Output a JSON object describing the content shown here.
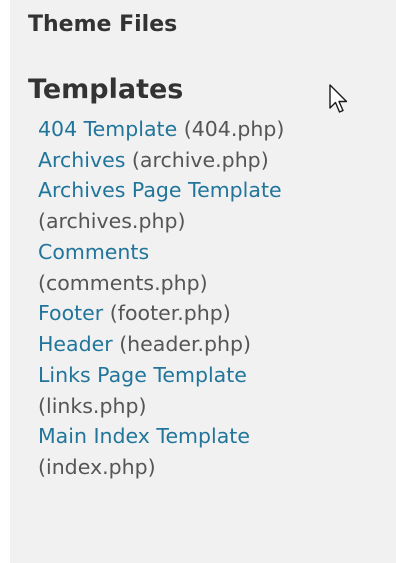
{
  "sidebar": {
    "title": "Theme Files",
    "section_title": "Templates",
    "files": [
      {
        "label": "404 Template",
        "file": "(404.php)",
        "wrap": false
      },
      {
        "label": "Archives",
        "file": "(archive.php)",
        "wrap": false
      },
      {
        "label": "Archives Page Template",
        "file": "(archives.php)",
        "wrap": true
      },
      {
        "label": "Comments",
        "file": "(comments.php)",
        "wrap": true
      },
      {
        "label": "Footer",
        "file": "(footer.php)",
        "wrap": false
      },
      {
        "label": "Header",
        "file": "(header.php)",
        "wrap": false
      },
      {
        "label": "Links Page Template",
        "file": "(links.php)",
        "wrap": true
      },
      {
        "label": "Main Index Template",
        "file": "(index.php)",
        "wrap": true
      }
    ]
  },
  "colors": {
    "link": "#21759b",
    "filename": "#555555",
    "heading": "#333333",
    "panel_bg": "#f1f1f1"
  },
  "cursor": {
    "icon": "mouse-pointer-icon"
  }
}
